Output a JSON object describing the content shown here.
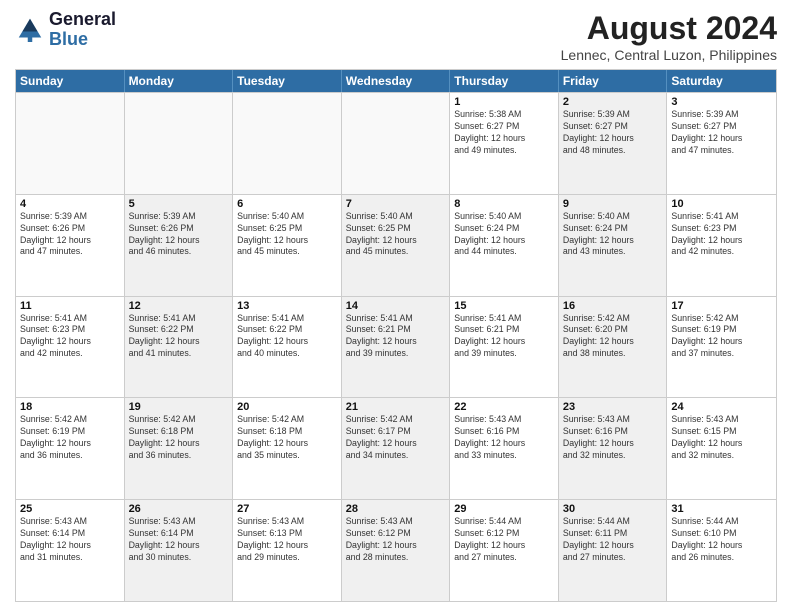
{
  "header": {
    "logo_line1": "General",
    "logo_line2": "Blue",
    "month_year": "August 2024",
    "location": "Lennec, Central Luzon, Philippines"
  },
  "weekdays": [
    "Sunday",
    "Monday",
    "Tuesday",
    "Wednesday",
    "Thursday",
    "Friday",
    "Saturday"
  ],
  "rows": [
    [
      {
        "day": "",
        "info": "",
        "shaded": false,
        "empty": true
      },
      {
        "day": "",
        "info": "",
        "shaded": false,
        "empty": true
      },
      {
        "day": "",
        "info": "",
        "shaded": false,
        "empty": true
      },
      {
        "day": "",
        "info": "",
        "shaded": false,
        "empty": true
      },
      {
        "day": "1",
        "info": "Sunrise: 5:38 AM\nSunset: 6:27 PM\nDaylight: 12 hours\nand 49 minutes.",
        "shaded": false,
        "empty": false
      },
      {
        "day": "2",
        "info": "Sunrise: 5:39 AM\nSunset: 6:27 PM\nDaylight: 12 hours\nand 48 minutes.",
        "shaded": true,
        "empty": false
      },
      {
        "day": "3",
        "info": "Sunrise: 5:39 AM\nSunset: 6:27 PM\nDaylight: 12 hours\nand 47 minutes.",
        "shaded": false,
        "empty": false
      }
    ],
    [
      {
        "day": "4",
        "info": "Sunrise: 5:39 AM\nSunset: 6:26 PM\nDaylight: 12 hours\nand 47 minutes.",
        "shaded": false,
        "empty": false
      },
      {
        "day": "5",
        "info": "Sunrise: 5:39 AM\nSunset: 6:26 PM\nDaylight: 12 hours\nand 46 minutes.",
        "shaded": true,
        "empty": false
      },
      {
        "day": "6",
        "info": "Sunrise: 5:40 AM\nSunset: 6:25 PM\nDaylight: 12 hours\nand 45 minutes.",
        "shaded": false,
        "empty": false
      },
      {
        "day": "7",
        "info": "Sunrise: 5:40 AM\nSunset: 6:25 PM\nDaylight: 12 hours\nand 45 minutes.",
        "shaded": true,
        "empty": false
      },
      {
        "day": "8",
        "info": "Sunrise: 5:40 AM\nSunset: 6:24 PM\nDaylight: 12 hours\nand 44 minutes.",
        "shaded": false,
        "empty": false
      },
      {
        "day": "9",
        "info": "Sunrise: 5:40 AM\nSunset: 6:24 PM\nDaylight: 12 hours\nand 43 minutes.",
        "shaded": true,
        "empty": false
      },
      {
        "day": "10",
        "info": "Sunrise: 5:41 AM\nSunset: 6:23 PM\nDaylight: 12 hours\nand 42 minutes.",
        "shaded": false,
        "empty": false
      }
    ],
    [
      {
        "day": "11",
        "info": "Sunrise: 5:41 AM\nSunset: 6:23 PM\nDaylight: 12 hours\nand 42 minutes.",
        "shaded": false,
        "empty": false
      },
      {
        "day": "12",
        "info": "Sunrise: 5:41 AM\nSunset: 6:22 PM\nDaylight: 12 hours\nand 41 minutes.",
        "shaded": true,
        "empty": false
      },
      {
        "day": "13",
        "info": "Sunrise: 5:41 AM\nSunset: 6:22 PM\nDaylight: 12 hours\nand 40 minutes.",
        "shaded": false,
        "empty": false
      },
      {
        "day": "14",
        "info": "Sunrise: 5:41 AM\nSunset: 6:21 PM\nDaylight: 12 hours\nand 39 minutes.",
        "shaded": true,
        "empty": false
      },
      {
        "day": "15",
        "info": "Sunrise: 5:41 AM\nSunset: 6:21 PM\nDaylight: 12 hours\nand 39 minutes.",
        "shaded": false,
        "empty": false
      },
      {
        "day": "16",
        "info": "Sunrise: 5:42 AM\nSunset: 6:20 PM\nDaylight: 12 hours\nand 38 minutes.",
        "shaded": true,
        "empty": false
      },
      {
        "day": "17",
        "info": "Sunrise: 5:42 AM\nSunset: 6:19 PM\nDaylight: 12 hours\nand 37 minutes.",
        "shaded": false,
        "empty": false
      }
    ],
    [
      {
        "day": "18",
        "info": "Sunrise: 5:42 AM\nSunset: 6:19 PM\nDaylight: 12 hours\nand 36 minutes.",
        "shaded": false,
        "empty": false
      },
      {
        "day": "19",
        "info": "Sunrise: 5:42 AM\nSunset: 6:18 PM\nDaylight: 12 hours\nand 36 minutes.",
        "shaded": true,
        "empty": false
      },
      {
        "day": "20",
        "info": "Sunrise: 5:42 AM\nSunset: 6:18 PM\nDaylight: 12 hours\nand 35 minutes.",
        "shaded": false,
        "empty": false
      },
      {
        "day": "21",
        "info": "Sunrise: 5:42 AM\nSunset: 6:17 PM\nDaylight: 12 hours\nand 34 minutes.",
        "shaded": true,
        "empty": false
      },
      {
        "day": "22",
        "info": "Sunrise: 5:43 AM\nSunset: 6:16 PM\nDaylight: 12 hours\nand 33 minutes.",
        "shaded": false,
        "empty": false
      },
      {
        "day": "23",
        "info": "Sunrise: 5:43 AM\nSunset: 6:16 PM\nDaylight: 12 hours\nand 32 minutes.",
        "shaded": true,
        "empty": false
      },
      {
        "day": "24",
        "info": "Sunrise: 5:43 AM\nSunset: 6:15 PM\nDaylight: 12 hours\nand 32 minutes.",
        "shaded": false,
        "empty": false
      }
    ],
    [
      {
        "day": "25",
        "info": "Sunrise: 5:43 AM\nSunset: 6:14 PM\nDaylight: 12 hours\nand 31 minutes.",
        "shaded": false,
        "empty": false
      },
      {
        "day": "26",
        "info": "Sunrise: 5:43 AM\nSunset: 6:14 PM\nDaylight: 12 hours\nand 30 minutes.",
        "shaded": true,
        "empty": false
      },
      {
        "day": "27",
        "info": "Sunrise: 5:43 AM\nSunset: 6:13 PM\nDaylight: 12 hours\nand 29 minutes.",
        "shaded": false,
        "empty": false
      },
      {
        "day": "28",
        "info": "Sunrise: 5:43 AM\nSunset: 6:12 PM\nDaylight: 12 hours\nand 28 minutes.",
        "shaded": true,
        "empty": false
      },
      {
        "day": "29",
        "info": "Sunrise: 5:44 AM\nSunset: 6:12 PM\nDaylight: 12 hours\nand 27 minutes.",
        "shaded": false,
        "empty": false
      },
      {
        "day": "30",
        "info": "Sunrise: 5:44 AM\nSunset: 6:11 PM\nDaylight: 12 hours\nand 27 minutes.",
        "shaded": true,
        "empty": false
      },
      {
        "day": "31",
        "info": "Sunrise: 5:44 AM\nSunset: 6:10 PM\nDaylight: 12 hours\nand 26 minutes.",
        "shaded": false,
        "empty": false
      }
    ]
  ]
}
